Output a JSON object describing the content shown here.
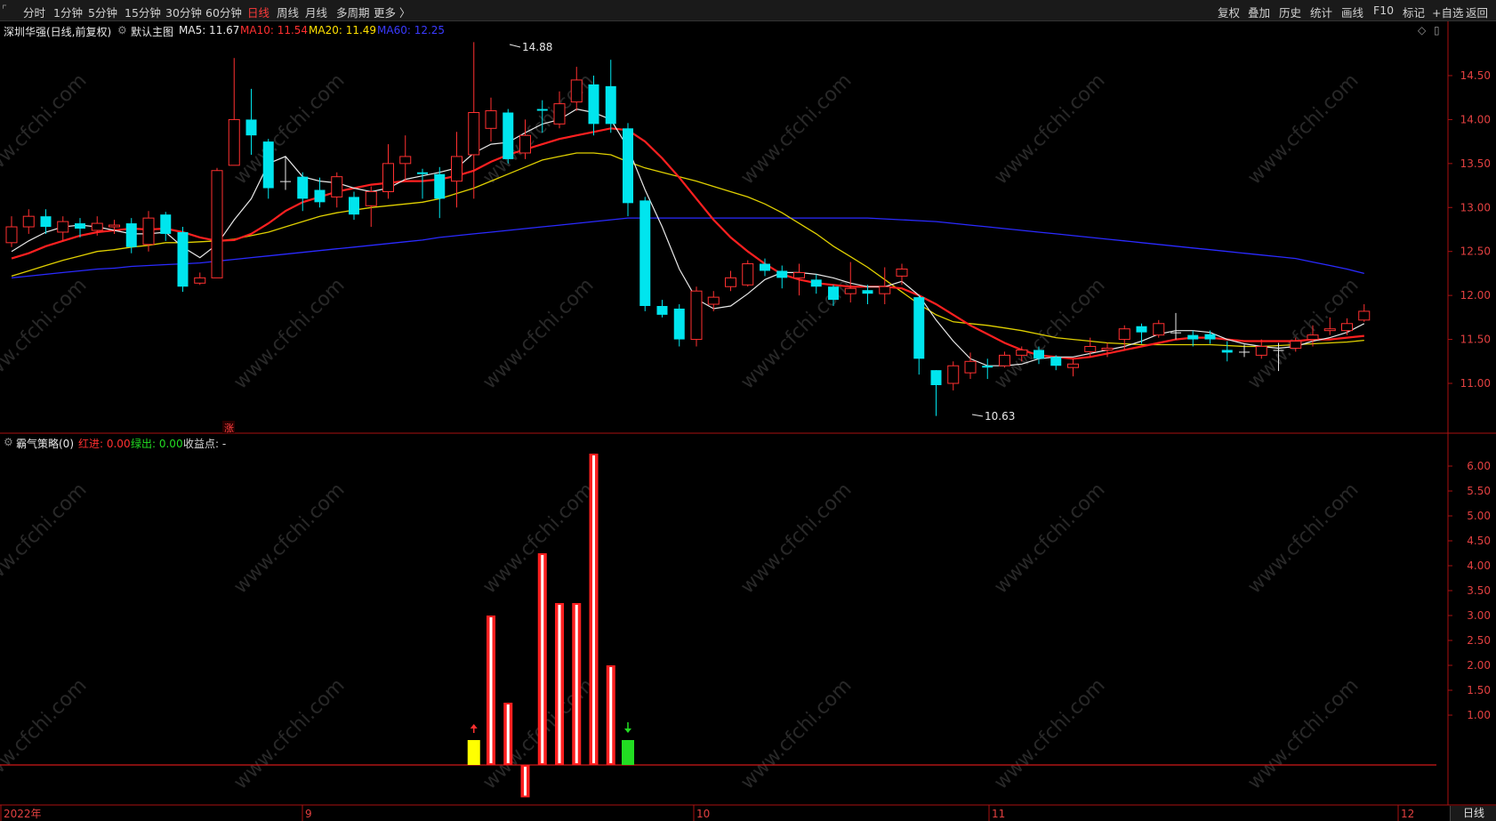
{
  "toolbar": {
    "left_items": [
      {
        "id": "fenshi",
        "label": "分时"
      },
      {
        "id": "1min",
        "label": "1分钟"
      },
      {
        "id": "5min",
        "label": "5分钟"
      },
      {
        "id": "15min",
        "label": "15分钟"
      },
      {
        "id": "30min",
        "label": "30分钟"
      },
      {
        "id": "60min",
        "label": "60分钟"
      },
      {
        "id": "day",
        "label": "日线",
        "active": true
      },
      {
        "id": "week",
        "label": "周线"
      },
      {
        "id": "month",
        "label": "月线"
      },
      {
        "id": "multi",
        "label": "多周期"
      },
      {
        "id": "more",
        "label": "更多 〉"
      }
    ],
    "right_items": [
      {
        "id": "fuquan",
        "label": "复权"
      },
      {
        "id": "diejia",
        "label": "叠加"
      },
      {
        "id": "lishi",
        "label": "历史"
      },
      {
        "id": "tongji",
        "label": "统计"
      },
      {
        "id": "huaxian",
        "label": "画线"
      },
      {
        "id": "f10",
        "label": "F10"
      },
      {
        "id": "biaoji",
        "label": "标记"
      },
      {
        "id": "zixuan",
        "label": "+自选"
      },
      {
        "id": "fanhui",
        "label": "返回"
      }
    ]
  },
  "main_chart": {
    "title": "深圳华强(日线,前复权)",
    "template_label": "默认主图",
    "ma_labels": [
      {
        "text": "MA5: 11.67",
        "color": "#e8e8e8"
      },
      {
        "text": "MA10: 11.54",
        "color": "#ff3030"
      },
      {
        "text": "MA20: 11.49",
        "color": "#ffe000"
      },
      {
        "text": "MA60: 12.25",
        "color": "#3a3aff"
      }
    ],
    "high_label": "14.88",
    "low_label": "10.63",
    "zhang_marker": "涨"
  },
  "indicator": {
    "name": "霸气策略(0)",
    "fields": [
      {
        "text": "红进: 0.00",
        "color": "#ff3030"
      },
      {
        "text": "绿出: 0.00",
        "color": "#22dd22"
      },
      {
        "text": "收益点: -",
        "color": "#d8d8d8"
      }
    ]
  },
  "x_axis_labels": [
    "2022年",
    "9",
    "10",
    "11",
    "12"
  ],
  "bottom_tab": "日线",
  "watermark": "www.cfchi.com",
  "colors": {
    "up": "#ff3030",
    "down": "#00e5ee",
    "ma5": "#e8e8e8",
    "ma10": "#ff2020",
    "ma20": "#e0d000",
    "ma60": "#2a2aff",
    "axis": "#aa1111",
    "yellow_bar": "#ffff00",
    "green_bar": "#22dd22"
  },
  "chart_data": [
    {
      "type": "candlestick",
      "title": "深圳华强(日线,前复权)",
      "ylim": [
        10.4,
        14.9
      ],
      "y_ticks": [
        "11.00",
        "11.50",
        "12.00",
        "12.50",
        "13.00",
        "13.50",
        "14.00",
        "14.50"
      ],
      "candles": [
        [
          12.6,
          12.78,
          12.9,
          12.55
        ],
        [
          12.78,
          12.9,
          12.98,
          12.7
        ],
        [
          12.9,
          12.78,
          12.98,
          12.7
        ],
        [
          12.72,
          12.84,
          12.9,
          12.62
        ],
        [
          12.82,
          12.76,
          12.88,
          12.66
        ],
        [
          12.74,
          12.82,
          12.9,
          12.68
        ],
        [
          12.78,
          12.8,
          12.86,
          12.7
        ],
        [
          12.82,
          12.55,
          12.88,
          12.48
        ],
        [
          12.58,
          12.88,
          12.96,
          12.5
        ],
        [
          12.92,
          12.7,
          12.95,
          12.62
        ],
        [
          12.72,
          12.1,
          12.78,
          12.04
        ],
        [
          12.14,
          12.2,
          12.26,
          12.12
        ],
        [
          12.2,
          13.42,
          13.45,
          12.2
        ],
        [
          13.48,
          14.0,
          14.7,
          13.48
        ],
        [
          14.0,
          13.82,
          14.35,
          13.6
        ],
        [
          13.75,
          13.22,
          13.78,
          13.1
        ],
        [
          13.3,
          13.3,
          13.58,
          13.2
        ],
        [
          13.35,
          13.1,
          13.4,
          12.96
        ],
        [
          13.2,
          13.06,
          13.34,
          13.0
        ],
        [
          13.12,
          13.35,
          13.4,
          13.0
        ],
        [
          13.12,
          12.92,
          13.18,
          12.86
        ],
        [
          13.02,
          13.18,
          13.24,
          12.78
        ],
        [
          13.18,
          13.5,
          13.72,
          13.1
        ],
        [
          13.5,
          13.58,
          13.82,
          13.3
        ],
        [
          13.4,
          13.38,
          13.44,
          13.1
        ],
        [
          13.38,
          13.1,
          13.46,
          12.88
        ],
        [
          13.3,
          13.58,
          13.86,
          13.0
        ],
        [
          13.6,
          14.08,
          14.88,
          13.1
        ],
        [
          13.9,
          14.1,
          14.25,
          13.75
        ],
        [
          14.08,
          13.55,
          14.12,
          13.5
        ],
        [
          13.62,
          13.82,
          14.0,
          13.55
        ],
        [
          14.12,
          14.1,
          14.22,
          13.85
        ],
        [
          13.95,
          14.18,
          14.32,
          13.9
        ],
        [
          14.2,
          14.45,
          14.6,
          14.1
        ],
        [
          14.4,
          13.95,
          14.5,
          13.82
        ],
        [
          14.38,
          13.95,
          14.68,
          13.85
        ],
        [
          13.9,
          13.05,
          13.96,
          12.9
        ],
        [
          13.08,
          11.88,
          13.12,
          11.82
        ],
        [
          11.88,
          11.78,
          11.95,
          11.75
        ],
        [
          11.85,
          11.5,
          11.9,
          11.42
        ],
        [
          11.5,
          12.05,
          12.1,
          11.42
        ],
        [
          11.9,
          11.98,
          12.05,
          11.82
        ],
        [
          12.1,
          12.2,
          12.28,
          12.05
        ],
        [
          12.12,
          12.36,
          12.4,
          12.1
        ],
        [
          12.36,
          12.28,
          12.42,
          12.22
        ],
        [
          12.28,
          12.2,
          12.34,
          12.08
        ],
        [
          12.2,
          12.26,
          12.36,
          12.0
        ],
        [
          12.18,
          12.1,
          12.24,
          12.02
        ],
        [
          12.1,
          11.95,
          12.12,
          11.88
        ],
        [
          12.02,
          12.08,
          12.38,
          11.92
        ],
        [
          12.06,
          12.02,
          12.12,
          11.9
        ],
        [
          12.02,
          12.1,
          12.32,
          11.9
        ],
        [
          12.22,
          12.3,
          12.36,
          12.12
        ],
        [
          11.98,
          11.28,
          12.0,
          11.1
        ],
        [
          11.15,
          10.98,
          11.15,
          10.63
        ],
        [
          11.0,
          11.2,
          11.25,
          10.92
        ],
        [
          11.12,
          11.25,
          11.35,
          11.05
        ],
        [
          11.2,
          11.18,
          11.28,
          11.05
        ],
        [
          11.2,
          11.32,
          11.36,
          11.18
        ],
        [
          11.32,
          11.38,
          11.42,
          11.25
        ],
        [
          11.38,
          11.28,
          11.42,
          11.22
        ],
        [
          11.3,
          11.2,
          11.32,
          11.15
        ],
        [
          11.18,
          11.22,
          11.28,
          11.08
        ],
        [
          11.36,
          11.42,
          11.52,
          11.3
        ],
        [
          11.38,
          11.4,
          11.46,
          11.3
        ],
        [
          11.5,
          11.62,
          11.66,
          11.38
        ],
        [
          11.65,
          11.58,
          11.68,
          11.45
        ],
        [
          11.55,
          11.68,
          11.72,
          11.52
        ],
        [
          11.58,
          11.58,
          11.8,
          11.5
        ],
        [
          11.55,
          11.5,
          11.6,
          11.42
        ],
        [
          11.56,
          11.5,
          11.6,
          11.45
        ],
        [
          11.38,
          11.35,
          11.48,
          11.25
        ],
        [
          11.36,
          11.36,
          11.44,
          11.3
        ],
        [
          11.32,
          11.42,
          11.5,
          11.28
        ],
        [
          11.38,
          11.38,
          11.46,
          11.14
        ],
        [
          11.4,
          11.48,
          11.52,
          11.36
        ],
        [
          11.5,
          11.55,
          11.66,
          11.42
        ],
        [
          11.6,
          11.62,
          11.75,
          11.55
        ],
        [
          11.6,
          11.68,
          11.74,
          11.55
        ],
        [
          11.72,
          11.82,
          11.9,
          11.7
        ]
      ],
      "ma5": [
        12.5,
        12.62,
        12.72,
        12.78,
        12.8,
        12.78,
        12.74,
        12.7,
        12.7,
        12.72,
        12.55,
        12.43,
        12.58,
        12.86,
        13.1,
        13.5,
        13.58,
        13.35,
        13.3,
        13.28,
        13.22,
        13.18,
        13.22,
        13.32,
        13.36,
        13.4,
        13.45,
        13.62,
        13.72,
        13.74,
        13.85,
        13.95,
        14.0,
        14.12,
        14.08,
        14.0,
        13.68,
        13.2,
        12.78,
        12.3,
        11.96,
        11.85,
        11.88,
        12.02,
        12.18,
        12.26,
        12.26,
        12.24,
        12.2,
        12.14,
        12.1,
        12.1,
        12.16,
        12.0,
        11.72,
        11.48,
        11.28,
        11.2,
        11.2,
        11.22,
        11.28,
        11.3,
        11.3,
        11.34,
        11.38,
        11.42,
        11.48,
        11.56,
        11.6,
        11.6,
        11.58,
        11.5,
        11.45,
        11.42,
        11.4,
        11.42,
        11.48,
        11.52,
        11.58,
        11.68
      ],
      "ma10": [
        12.42,
        12.48,
        12.56,
        12.62,
        12.68,
        12.72,
        12.74,
        12.76,
        12.75,
        12.76,
        12.72,
        12.66,
        12.62,
        12.63,
        12.7,
        12.82,
        12.96,
        13.06,
        13.12,
        13.18,
        13.22,
        13.26,
        13.28,
        13.3,
        13.3,
        13.32,
        13.36,
        13.42,
        13.52,
        13.6,
        13.66,
        13.72,
        13.78,
        13.82,
        13.86,
        13.9,
        13.88,
        13.75,
        13.56,
        13.34,
        13.1,
        12.86,
        12.66,
        12.5,
        12.36,
        12.24,
        12.18,
        12.14,
        12.12,
        12.1,
        12.1,
        12.1,
        12.08,
        12.0,
        11.9,
        11.78,
        11.66,
        11.56,
        11.46,
        11.38,
        11.32,
        11.3,
        11.28,
        11.3,
        11.34,
        11.38,
        11.42,
        11.46,
        11.5,
        11.52,
        11.52,
        11.5,
        11.48,
        11.48,
        11.48,
        11.48,
        11.5,
        11.5,
        11.52,
        11.54
      ],
      "ma20": [
        12.22,
        12.28,
        12.34,
        12.4,
        12.45,
        12.5,
        12.52,
        12.55,
        12.57,
        12.6,
        12.6,
        12.61,
        12.62,
        12.64,
        12.68,
        12.72,
        12.78,
        12.84,
        12.9,
        12.94,
        12.97,
        13.0,
        13.02,
        13.04,
        13.06,
        13.1,
        13.16,
        13.22,
        13.3,
        13.38,
        13.46,
        13.54,
        13.58,
        13.62,
        13.62,
        13.6,
        13.52,
        13.45,
        13.4,
        13.35,
        13.3,
        13.24,
        13.18,
        13.12,
        13.04,
        12.94,
        12.82,
        12.7,
        12.56,
        12.44,
        12.32,
        12.18,
        12.04,
        11.9,
        11.78,
        11.7,
        11.68,
        11.66,
        11.63,
        11.6,
        11.56,
        11.52,
        11.5,
        11.48,
        11.46,
        11.45,
        11.44,
        11.44,
        11.44,
        11.44,
        11.44,
        11.43,
        11.42,
        11.42,
        11.43,
        11.44,
        11.45,
        11.46,
        11.47,
        11.49
      ],
      "ma60": [
        12.2,
        12.22,
        12.24,
        12.26,
        12.28,
        12.3,
        12.31,
        12.33,
        12.34,
        12.35,
        12.36,
        12.37,
        12.39,
        12.41,
        12.43,
        12.45,
        12.47,
        12.49,
        12.51,
        12.53,
        12.55,
        12.57,
        12.59,
        12.61,
        12.63,
        12.66,
        12.68,
        12.7,
        12.72,
        12.74,
        12.76,
        12.78,
        12.8,
        12.82,
        12.84,
        12.86,
        12.88,
        12.88,
        12.88,
        12.88,
        12.88,
        12.88,
        12.88,
        12.88,
        12.88,
        12.88,
        12.88,
        12.88,
        12.88,
        12.88,
        12.88,
        12.87,
        12.86,
        12.85,
        12.84,
        12.82,
        12.8,
        12.78,
        12.76,
        12.74,
        12.72,
        12.7,
        12.68,
        12.66,
        12.64,
        12.62,
        12.6,
        12.58,
        12.56,
        12.54,
        12.52,
        12.5,
        12.48,
        12.46,
        12.44,
        12.42,
        12.38,
        12.34,
        12.3,
        12.25
      ]
    },
    {
      "type": "bar",
      "title": "霸气策略(0)",
      "ylim": [
        -0.7,
        6.3
      ],
      "y_ticks": [
        "1.00",
        "1.50",
        "2.00",
        "2.50",
        "3.00",
        "3.50",
        "4.00",
        "4.50",
        "5.00",
        "5.50",
        "6.00"
      ],
      "bars": [
        {
          "index": 27,
          "value": 0.5,
          "kind": "yellow",
          "arrow": "up"
        },
        {
          "index": 28,
          "value": 3.0,
          "kind": "red"
        },
        {
          "index": 29,
          "value": 1.25,
          "kind": "red"
        },
        {
          "index": 30,
          "value": -0.65,
          "kind": "red"
        },
        {
          "index": 31,
          "value": 4.25,
          "kind": "red"
        },
        {
          "index": 32,
          "value": 3.25,
          "kind": "red"
        },
        {
          "index": 33,
          "value": 3.25,
          "kind": "red"
        },
        {
          "index": 34,
          "value": 6.25,
          "kind": "red"
        },
        {
          "index": 35,
          "value": 2.0,
          "kind": "red"
        },
        {
          "index": 36,
          "value": 0.5,
          "kind": "green",
          "arrow": "down"
        }
      ]
    }
  ]
}
